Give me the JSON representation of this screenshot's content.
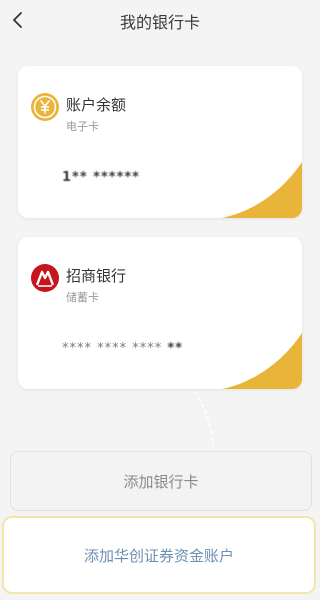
{
  "header": {
    "title": "我的银行卡"
  },
  "cards": [
    {
      "name": "账户余额",
      "type": "电子卡",
      "number_masked": "1** ******"
    },
    {
      "name": "招商银行",
      "type": "储蓄卡",
      "number_prefix": "**** **** ****",
      "number_suffix": "**"
    }
  ],
  "actions": {
    "add_bank_label": "添加银行卡",
    "add_securities_label": "添加华创证券资金账户"
  },
  "colors": {
    "accent_gold": "#e9b43a",
    "bank_red": "#c4161c",
    "link_blue": "#6d8fb3"
  }
}
